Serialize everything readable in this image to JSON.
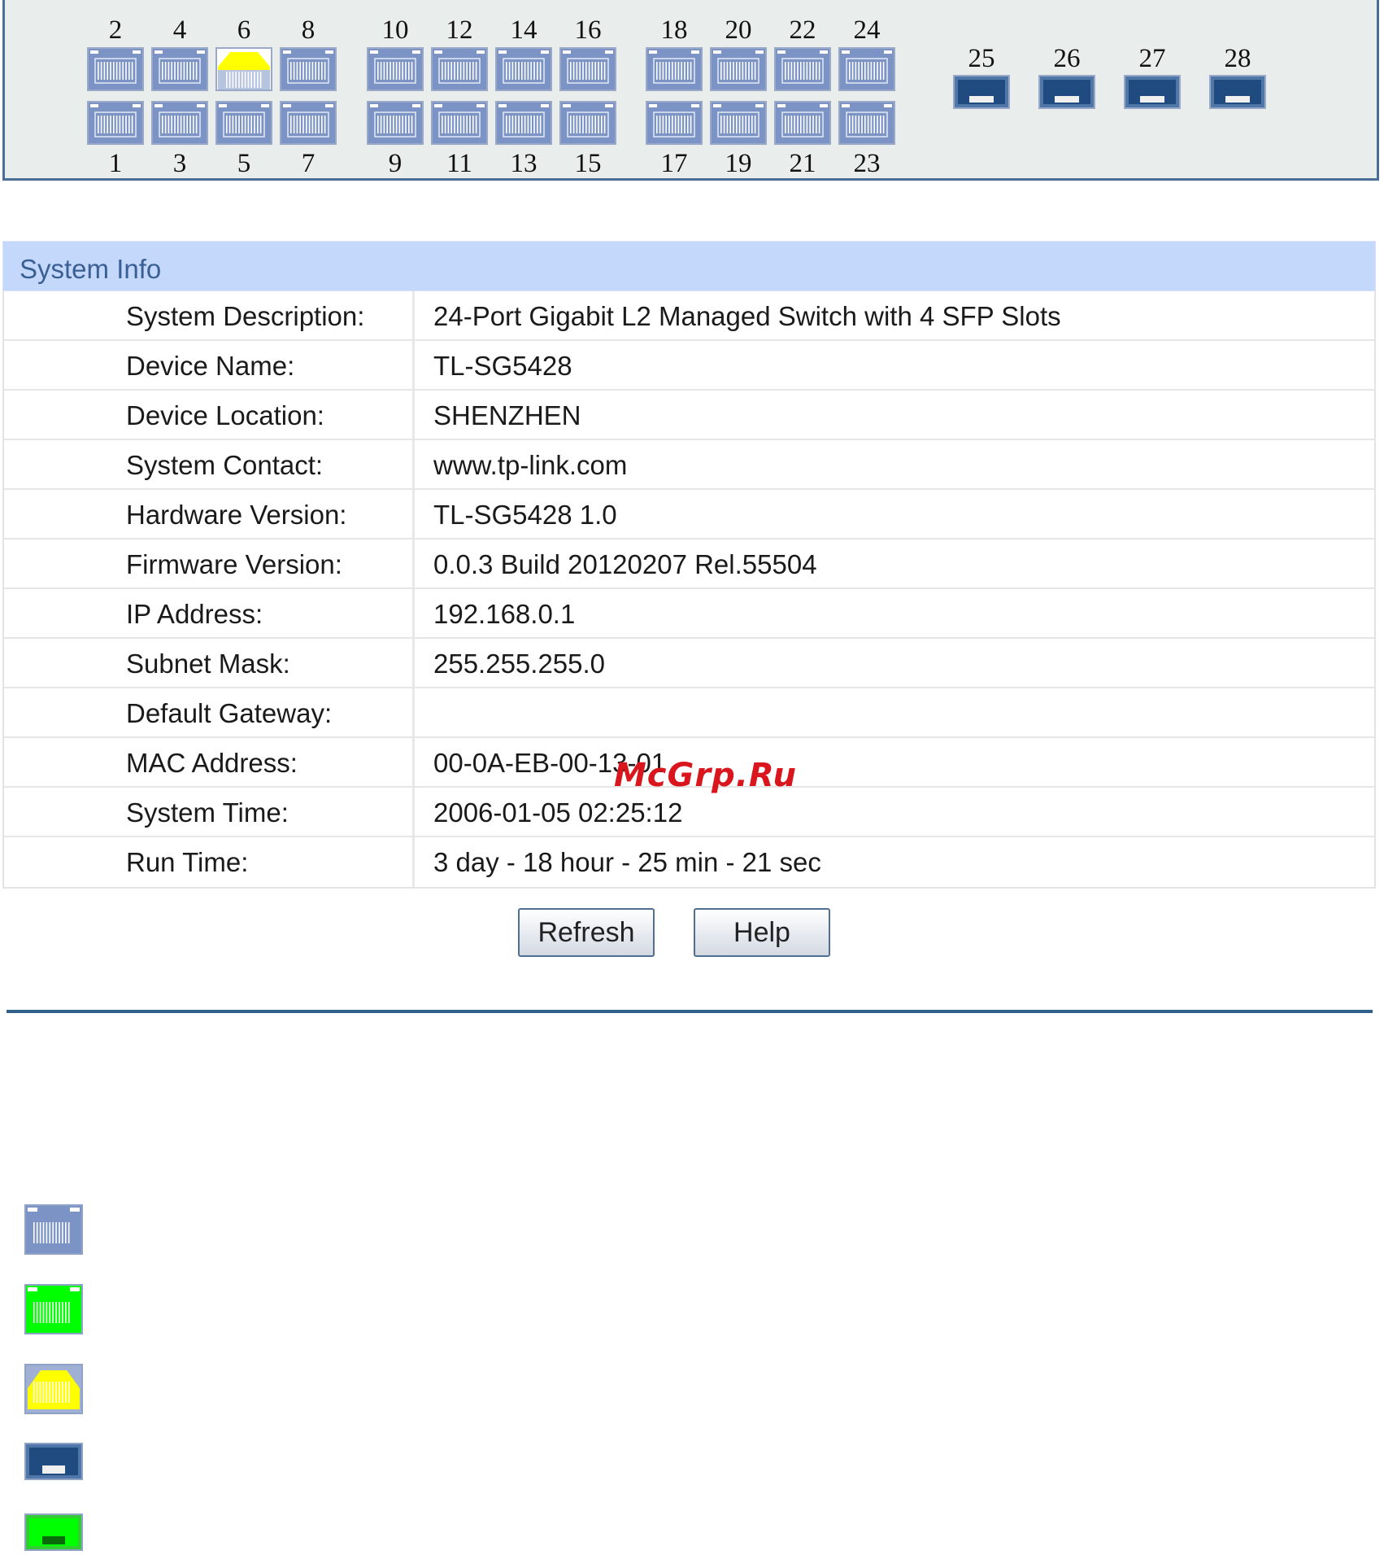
{
  "panel": {
    "top_ports": [
      "2",
      "4",
      "6",
      "8",
      "10",
      "12",
      "14",
      "16",
      "18",
      "20",
      "22",
      "24"
    ],
    "bottom_ports": [
      "1",
      "3",
      "5",
      "7",
      "9",
      "11",
      "13",
      "15",
      "17",
      "19",
      "21",
      "23"
    ],
    "active_port": "6",
    "sfp_ports": [
      "25",
      "26",
      "27",
      "28"
    ],
    "colors": {
      "port_idle": "#7b93c5",
      "port_active": "#ffff00",
      "sfp_idle": "#4f77a8",
      "background": "#e9edec"
    }
  },
  "system_info": {
    "title": "System Info",
    "rows": [
      {
        "label": "System Description:",
        "value": "24-Port Gigabit L2 Managed Switch with 4 SFP Slots"
      },
      {
        "label": "Device Name:",
        "value": "TL-SG5428"
      },
      {
        "label": "Device Location:",
        "value": "SHENZHEN"
      },
      {
        "label": "System Contact:",
        "value": "www.tp-link.com"
      },
      {
        "label": "Hardware Version:",
        "value": "TL-SG5428 1.0"
      },
      {
        "label": "Firmware Version:",
        "value": "0.0.3 Build 20120207 Rel.55504"
      },
      {
        "label": "IP Address:",
        "value": "192.168.0.1"
      },
      {
        "label": "Subnet Mask:",
        "value": "255.255.255.0"
      },
      {
        "label": "Default Gateway:",
        "value": ""
      },
      {
        "label": "MAC Address:",
        "value": "00-0A-EB-00-13-01"
      },
      {
        "label": "System Time:",
        "value": "2006-01-05 02:25:12"
      },
      {
        "label": "Run Time:",
        "value": "3 day - 18 hour - 25 min - 21 sec"
      }
    ]
  },
  "buttons": {
    "refresh": "Refresh",
    "help": "Help"
  },
  "legend": [
    {
      "icon": "port-idle-icon",
      "color": "#7b93c5"
    },
    {
      "icon": "port-linked-icon",
      "color": "#00ff00"
    },
    {
      "icon": "port-selected-icon",
      "color": "#ffff00"
    },
    {
      "icon": "sfp-idle-icon",
      "color": "#4f77a8"
    },
    {
      "icon": "sfp-linked-icon",
      "color": "#00ff00"
    }
  ],
  "watermark": "McGrp.Ru"
}
